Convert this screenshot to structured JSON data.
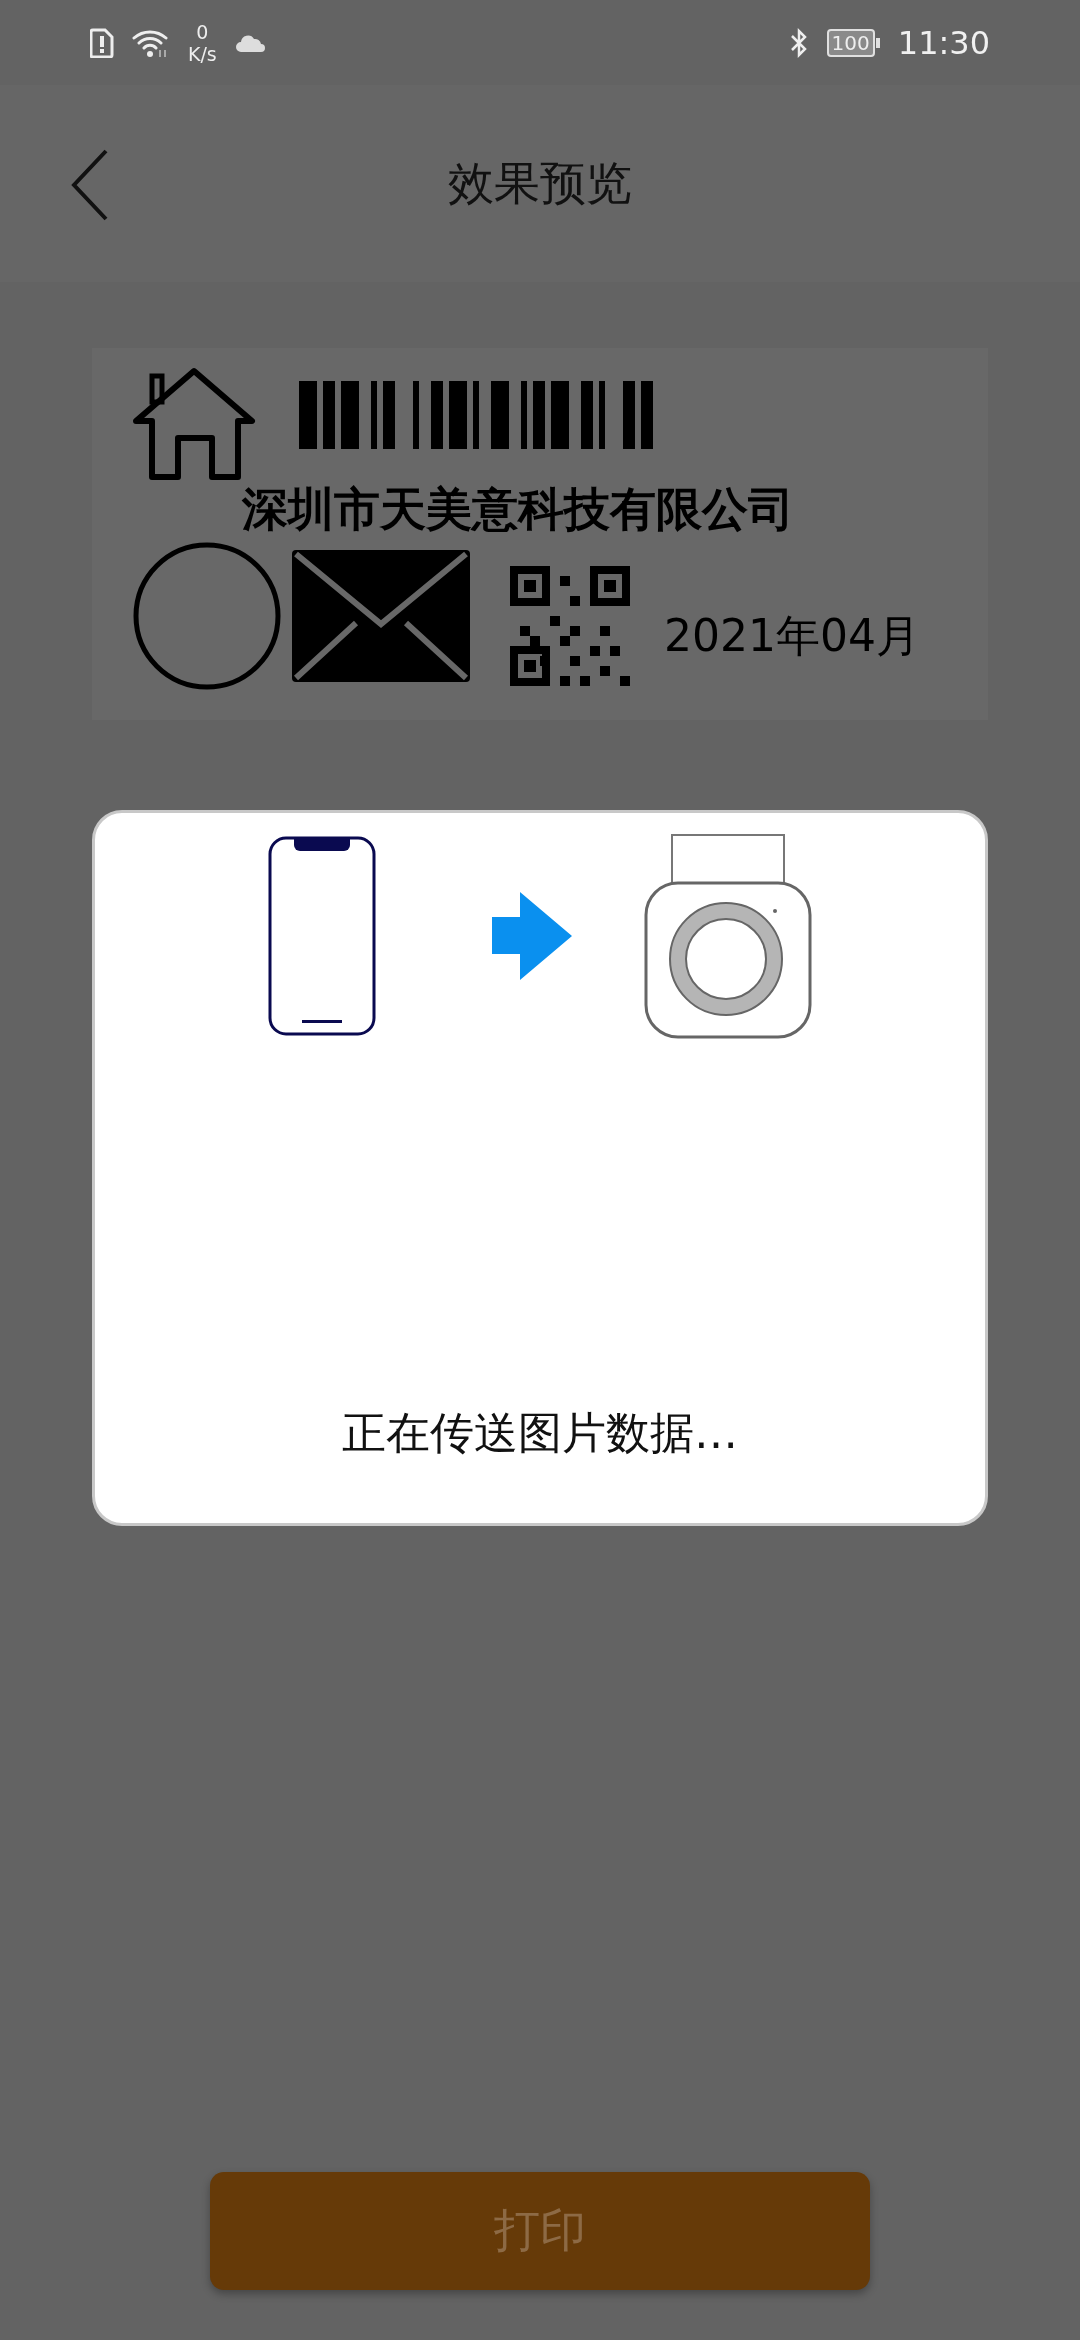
{
  "status_bar": {
    "network_speed_value": "0",
    "network_speed_unit": "K/s",
    "battery": "100",
    "time": "11:30"
  },
  "header": {
    "title": "效果预览"
  },
  "label_preview": {
    "company": "深圳市天美意科技有限公司",
    "date": "2021年04月"
  },
  "dialog": {
    "message": "正在传送图片数据…"
  },
  "print_button": {
    "label": "打印"
  }
}
